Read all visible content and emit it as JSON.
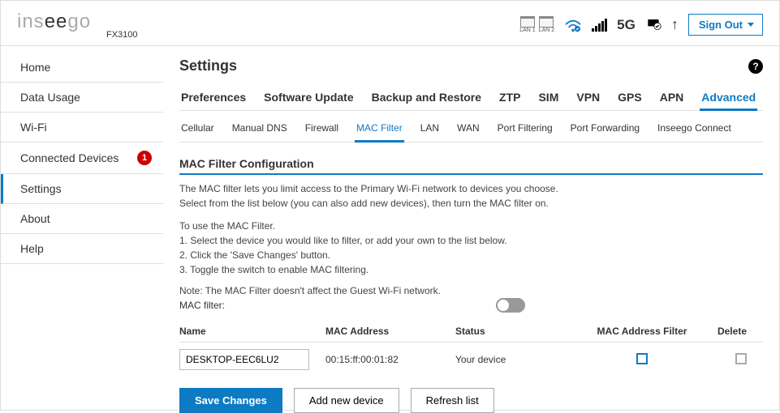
{
  "header": {
    "brand": "inseego",
    "model": "FX3100",
    "lan_labels": [
      "LAN 1",
      "LAN 2"
    ],
    "network_label": "5G",
    "signout_label": "Sign Out"
  },
  "sidebar": {
    "items": [
      {
        "label": "Home"
      },
      {
        "label": "Data Usage"
      },
      {
        "label": "Wi-Fi"
      },
      {
        "label": "Connected Devices",
        "badge": "1"
      },
      {
        "label": "Settings",
        "active": true
      },
      {
        "label": "About"
      },
      {
        "label": "Help"
      }
    ]
  },
  "main": {
    "title": "Settings",
    "tabs_primary": [
      "Preferences",
      "Software Update",
      "Backup and Restore",
      "ZTP",
      "SIM",
      "VPN",
      "GPS",
      "APN",
      "Advanced"
    ],
    "tabs_primary_active": "Advanced",
    "tabs_secondary": [
      "Cellular",
      "Manual DNS",
      "Firewall",
      "MAC Filter",
      "LAN",
      "WAN",
      "Port Filtering",
      "Port Forwarding",
      "Inseego Connect"
    ],
    "tabs_secondary_active": "MAC Filter",
    "section_title": "MAC Filter Configuration",
    "desc_line1": "The MAC filter lets you limit access to the Primary Wi-Fi network to devices you choose.",
    "desc_line2": "Select from the list below (you can also add new devices), then turn the MAC filter on.",
    "use_intro": "To use the MAC Filter.",
    "step1": "1. Select the device you would like to filter, or add your own to the list below.",
    "step2": "2. Click the 'Save Changes' button.",
    "step3": "3. Toggle the switch to enable MAC filtering.",
    "note": "Note: The MAC Filter doesn't affect the Guest Wi-Fi network.",
    "mac_filter_label": "MAC filter:",
    "table": {
      "headers": {
        "name": "Name",
        "mac": "MAC Address",
        "status": "Status",
        "filter": "MAC Address Filter",
        "delete": "Delete"
      },
      "rows": [
        {
          "name": "DESKTOP-EEC6LU2",
          "mac": "00:15:ff:00:01:82",
          "status": "Your device"
        }
      ]
    },
    "buttons": {
      "save": "Save Changes",
      "add": "Add new device",
      "refresh": "Refresh list"
    }
  }
}
